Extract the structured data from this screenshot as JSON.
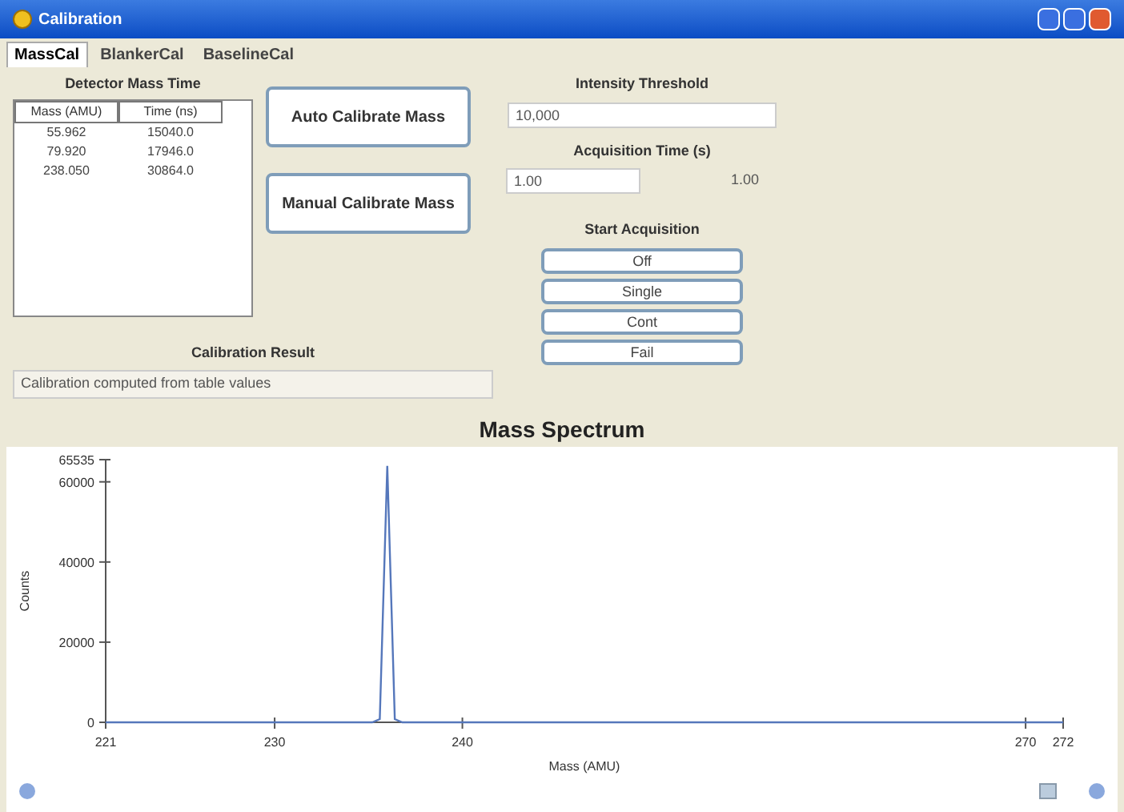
{
  "window": {
    "title": "Calibration"
  },
  "tabs": [
    {
      "label": "MassCal",
      "selected": true
    },
    {
      "label": "BlankerCal",
      "selected": false
    },
    {
      "label": "BaselineCal",
      "selected": false
    }
  ],
  "detector_table": {
    "title": "Detector Mass Time",
    "columns": [
      "Mass (AMU)",
      "Time (ns)"
    ],
    "rows": [
      [
        "55.962",
        "15040.0"
      ],
      [
        "79.920",
        "17946.0"
      ],
      [
        "238.050",
        "30864.0"
      ]
    ]
  },
  "calibrate_buttons": [
    "Auto Calibrate Mass",
    "Manual Calibrate Mass"
  ],
  "intensity_threshold": {
    "label": "Intensity Threshold",
    "value": "10,000"
  },
  "acquisition_time": {
    "label": "Acquisition Time (s)",
    "value": "1.00",
    "reading": "1.00"
  },
  "start_acquisition": {
    "label": "Start Acquisition",
    "buttons": [
      "Off",
      "Single",
      "Cont",
      "Fail"
    ]
  },
  "calibration_result": {
    "label": "Calibration Result",
    "value": "Calibration computed from table values"
  },
  "spectrum": {
    "title": "Mass Spectrum",
    "chart_data": {
      "type": "line",
      "xlabel": "Mass (AMU)",
      "ylabel": "Counts",
      "x": [
        221,
        235.2,
        235.6,
        236.0,
        236.4,
        236.8,
        272
      ],
      "series": [
        {
          "color": "#5577bb",
          "values": [
            0,
            0,
            800,
            64000,
            800,
            0,
            0
          ]
        }
      ],
      "xlim": [
        221,
        272
      ],
      "ylim": [
        0,
        65535
      ],
      "xticks": [
        221,
        230,
        240,
        270,
        272
      ],
      "yticks": [
        0,
        20000,
        40000,
        60000,
        {
          "value": 65535,
          "label": "65535"
        }
      ]
    }
  }
}
